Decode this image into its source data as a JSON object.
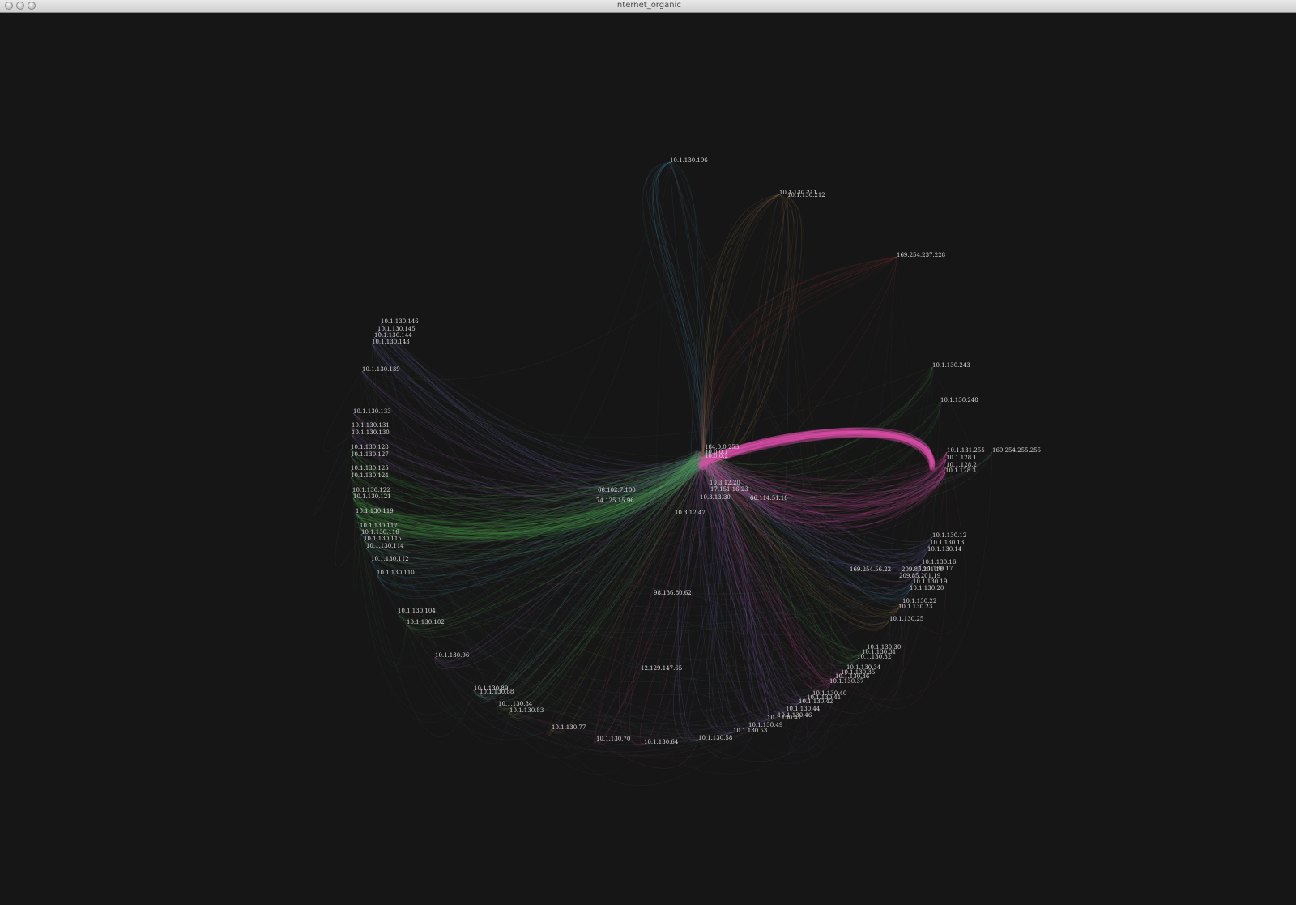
{
  "window": {
    "title": "internet_organic"
  },
  "colors": {
    "background": "#161616",
    "label": "#d9d9d9",
    "palette": [
      "#d94fa8",
      "#4ea84c",
      "#3e86a8",
      "#9a6bc9",
      "#a37a4a",
      "#5fa38d",
      "#7a7bd0"
    ]
  },
  "visualization": {
    "hub_labels": [
      "184.0.0.253",
      "10.0.0.1",
      "10.0.0.2"
    ],
    "nodes": [
      {
        "label": "10.1.130.196",
        "color": "#3e86a8",
        "weight": 1
      },
      {
        "label": "10.1.130.211",
        "color": "#a37a4a",
        "weight": 1
      },
      {
        "label": "10.1.130.212",
        "color": "#a37a4a",
        "weight": 1
      },
      {
        "label": "169.254.237.228",
        "color": "#a33a3a",
        "weight": 0.3
      },
      {
        "label": "10.1.130.146",
        "color": "#7a7bd0",
        "weight": 1
      },
      {
        "label": "10.1.130.145",
        "color": "#7a7bd0",
        "weight": 1
      },
      {
        "label": "10.1.130.144",
        "color": "#7a7bd0",
        "weight": 1
      },
      {
        "label": "10.1.130.143",
        "color": "#7a7bd0",
        "weight": 1
      },
      {
        "label": "10.1.130.139",
        "color": "#9a6bc9",
        "weight": 1
      },
      {
        "label": "10.1.130.133",
        "color": "#9a6bc9",
        "weight": 1
      },
      {
        "label": "10.1.130.131",
        "color": "#9a6bc9",
        "weight": 1
      },
      {
        "label": "10.1.130.130",
        "color": "#9a6bc9",
        "weight": 1
      },
      {
        "label": "10.1.130.128",
        "color": "#4ea84c",
        "weight": 1
      },
      {
        "label": "10.1.130.127",
        "color": "#4ea84c",
        "weight": 1
      },
      {
        "label": "10.1.130.125",
        "color": "#4ea84c",
        "weight": 1
      },
      {
        "label": "10.1.130.124",
        "color": "#4ea84c",
        "weight": 1
      },
      {
        "label": "10.1.130.122",
        "color": "#4ea84c",
        "weight": 2
      },
      {
        "label": "10.1.130.121",
        "color": "#4ea84c",
        "weight": 2
      },
      {
        "label": "10.1.130.119",
        "color": "#4ea84c",
        "weight": 2
      },
      {
        "label": "10.1.130.117",
        "color": "#5fa38d",
        "weight": 1
      },
      {
        "label": "10.1.130.116",
        "color": "#5fa38d",
        "weight": 1
      },
      {
        "label": "10.1.130.115",
        "color": "#5fa38d",
        "weight": 1
      },
      {
        "label": "10.1.130.114",
        "color": "#5fa38d",
        "weight": 1
      },
      {
        "label": "10.1.130.112",
        "color": "#3e86a8",
        "weight": 1
      },
      {
        "label": "10.1.130.110",
        "color": "#3e86a8",
        "weight": 1
      },
      {
        "label": "10.1.130.104",
        "color": "#4ea84c",
        "weight": 1
      },
      {
        "label": "10.1.130.102",
        "color": "#4ea84c",
        "weight": 1
      },
      {
        "label": "10.1.130.96",
        "color": "#9a6bc9",
        "weight": 1
      },
      {
        "label": "10.1.130.89",
        "color": "#5fa38d",
        "weight": 1
      },
      {
        "label": "10.1.130.88",
        "color": "#5fa38d",
        "weight": 1
      },
      {
        "label": "10.1.130.84",
        "color": "#4ea84c",
        "weight": 1
      },
      {
        "label": "10.1.130.83",
        "color": "#4ea84c",
        "weight": 1
      },
      {
        "label": "10.1.130.77",
        "color": "#a37a4a",
        "weight": 1
      },
      {
        "label": "10.1.130.70",
        "color": "#d94fa8",
        "weight": 1
      },
      {
        "label": "10.1.130.64",
        "color": "#d94fa8",
        "weight": 1
      },
      {
        "label": "10.1.130.58",
        "color": "#7a7bd0",
        "weight": 1
      },
      {
        "label": "10.1.130.53",
        "color": "#7a7bd0",
        "weight": 1
      },
      {
        "label": "10.1.130.49",
        "color": "#7a7bd0",
        "weight": 1
      },
      {
        "label": "10.1.130.47",
        "color": "#9a6bc9",
        "weight": 1
      },
      {
        "label": "10.1.130.46",
        "color": "#9a6bc9",
        "weight": 1
      },
      {
        "label": "10.1.130.44",
        "color": "#9a6bc9",
        "weight": 1
      },
      {
        "label": "10.1.130.42",
        "color": "#9a6bc9",
        "weight": 1
      },
      {
        "label": "10.1.130.41",
        "color": "#9a6bc9",
        "weight": 1
      },
      {
        "label": "10.1.130.40",
        "color": "#9a6bc9",
        "weight": 1
      },
      {
        "label": "10.1.130.37",
        "color": "#d94fa8",
        "weight": 1
      },
      {
        "label": "10.1.130.36",
        "color": "#d94fa8",
        "weight": 1
      },
      {
        "label": "10.1.130.35",
        "color": "#d94fa8",
        "weight": 1
      },
      {
        "label": "10.1.130.34",
        "color": "#d94fa8",
        "weight": 1
      },
      {
        "label": "10.1.130.32",
        "color": "#4ea84c",
        "weight": 1
      },
      {
        "label": "10.1.130.31",
        "color": "#4ea84c",
        "weight": 1
      },
      {
        "label": "10.1.130.30",
        "color": "#4ea84c",
        "weight": 1
      },
      {
        "label": "10.1.130.25",
        "color": "#a37a4a",
        "weight": 1
      },
      {
        "label": "10.1.130.23",
        "color": "#a37a4a",
        "weight": 1
      },
      {
        "label": "10.1.130.22",
        "color": "#a37a4a",
        "weight": 1
      },
      {
        "label": "10.1.130.20",
        "color": "#3e86a8",
        "weight": 1
      },
      {
        "label": "10.1.130.19",
        "color": "#3e86a8",
        "weight": 1
      },
      {
        "label": "10.1.130.17",
        "color": "#9a6bc9",
        "weight": 1
      },
      {
        "label": "10.1.130.16",
        "color": "#9a6bc9",
        "weight": 1
      },
      {
        "label": "10.1.130.14",
        "color": "#7a7bd0",
        "weight": 1
      },
      {
        "label": "10.1.130.13",
        "color": "#7a7bd0",
        "weight": 1
      },
      {
        "label": "10.1.130.12",
        "color": "#7a7bd0",
        "weight": 1
      },
      {
        "label": "10.1.131.255",
        "color": "#d94fa8",
        "weight": 3
      },
      {
        "label": "10.1.128.1",
        "color": "#d94fa8",
        "weight": 3
      },
      {
        "label": "10.1.128.2",
        "color": "#d94fa8",
        "weight": 3
      },
      {
        "label": "10.1.128.3",
        "color": "#d94fa8",
        "weight": 3
      },
      {
        "label": "169.254.255.255",
        "color": "#5fa38d",
        "weight": 0.5
      },
      {
        "label": "10.1.130.243",
        "color": "#4ea84c",
        "weight": 1
      },
      {
        "label": "10.1.130.248",
        "color": "#4ea84c",
        "weight": 1
      }
    ],
    "inner_nodes": [
      {
        "label": "66.102.7.100",
        "color": "#3e86a8"
      },
      {
        "label": "74.125.15.96",
        "color": "#3e86a8"
      },
      {
        "label": "10.3.12.20",
        "color": "#5fa38d"
      },
      {
        "label": "17.151.16.23",
        "color": "#5fa38d"
      },
      {
        "label": "10.3.13.30",
        "color": "#5fa38d"
      },
      {
        "label": "66.114.51.18",
        "color": "#3e86a8"
      },
      {
        "label": "10.3.12.47",
        "color": "#a37a4a"
      },
      {
        "label": "169.254.56.22",
        "color": "#a37a4a"
      },
      {
        "label": "209.85.201.18",
        "color": "#a37a4a"
      },
      {
        "label": "209.85.201.19",
        "color": "#a37a4a"
      },
      {
        "label": "98.136.80.62",
        "color": "#9a6bc9"
      },
      {
        "label": "12.129.147.65",
        "color": "#9a6bc9"
      }
    ]
  }
}
